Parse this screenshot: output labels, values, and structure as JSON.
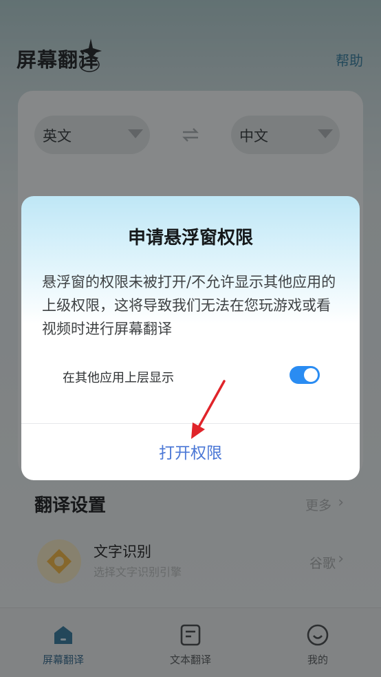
{
  "header": {
    "title": "屏幕翻译",
    "help_label": "帮助"
  },
  "languages": {
    "source": "英文",
    "target": "中文"
  },
  "settings": {
    "title": "翻译设置",
    "more_label": "更多",
    "ocr": {
      "title": "文字识别",
      "subtitle": "选择文字识别引擎",
      "engine": "谷歌"
    }
  },
  "bottom_nav": [
    {
      "label": "屏幕翻译",
      "icon": "home-icon",
      "active": true
    },
    {
      "label": "文本翻译",
      "icon": "document-icon",
      "active": false
    },
    {
      "label": "我的",
      "icon": "smiley-icon",
      "active": false
    }
  ],
  "dialog": {
    "title": "申请悬浮窗权限",
    "message": "悬浮窗的权限未被打开/不允许显示其他应用的上级权限，这将导致我们无法在您玩游戏或看视频时进行屏幕翻译",
    "toggle_label": "在其他应用上层显示",
    "toggle_on": true,
    "button_label": "打开权限"
  },
  "colors": {
    "accent": "#2A8CF2",
    "button_text": "#4A77D6",
    "arrow": "#E0242A"
  }
}
